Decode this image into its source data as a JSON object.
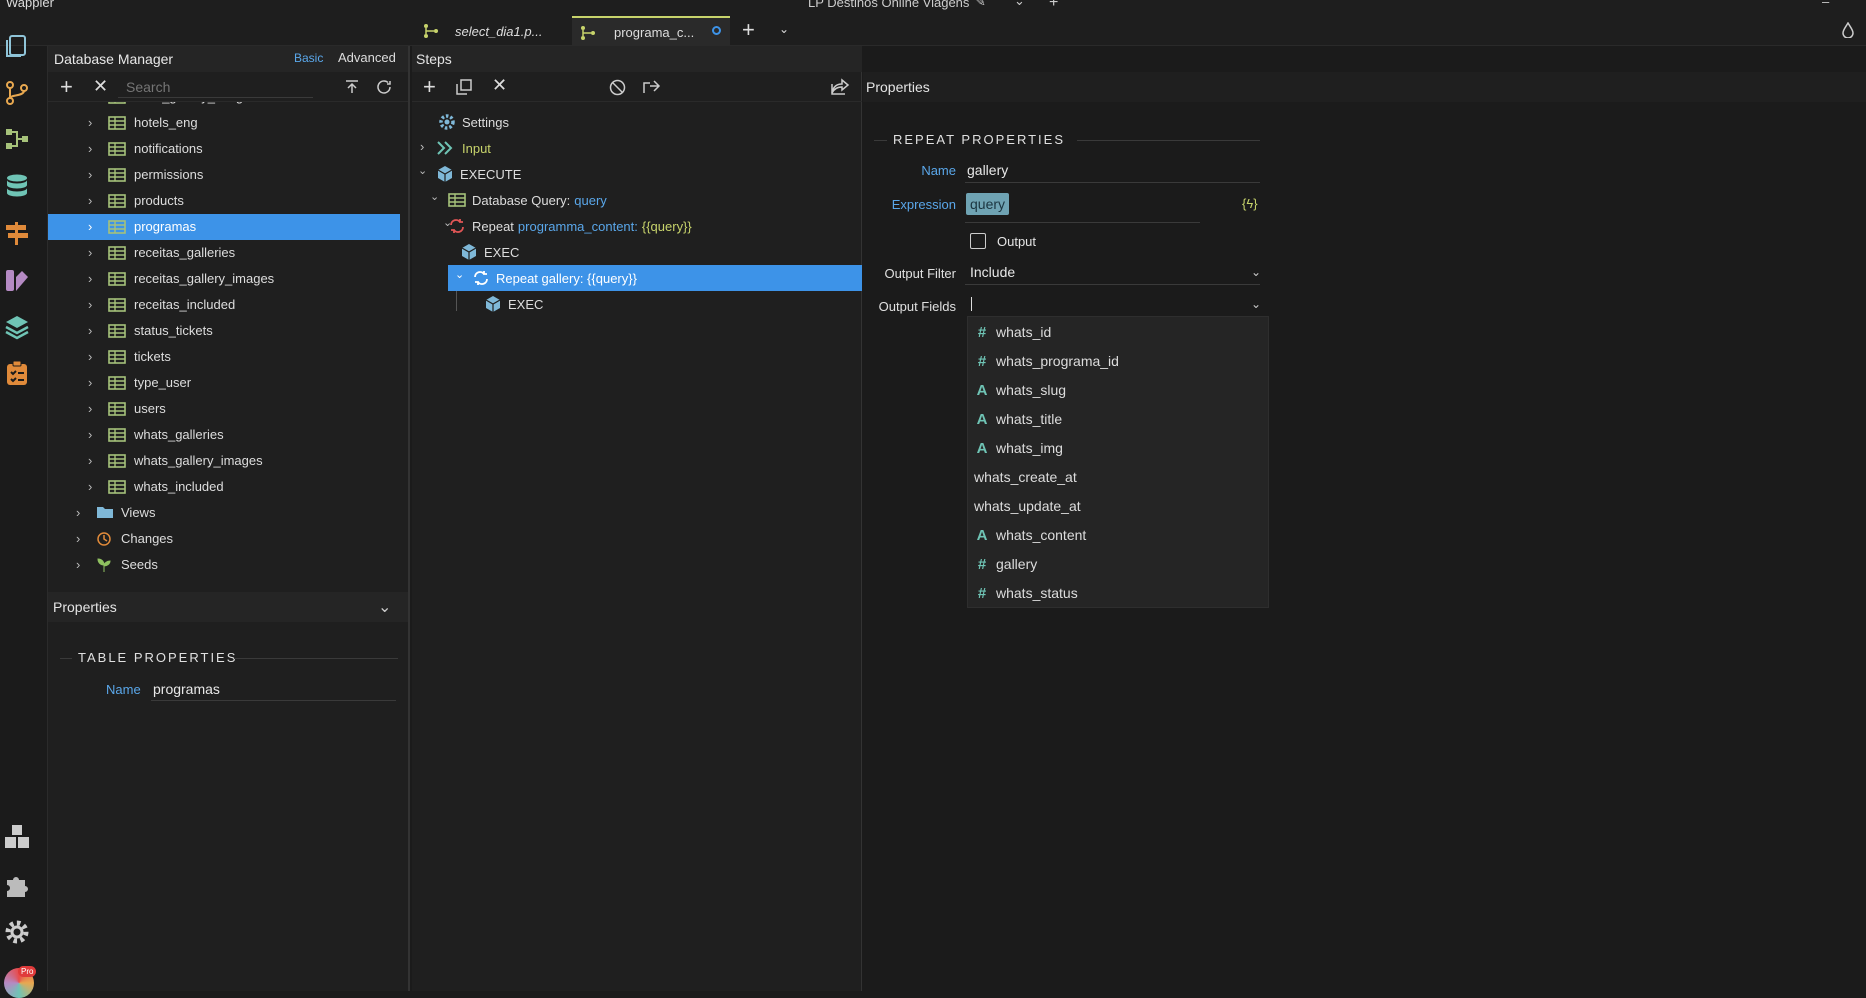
{
  "window": {
    "app_name": "Wappler",
    "project_title": "LP Destinos Online Viagens"
  },
  "tabs": [
    {
      "label": "select_dia1.p...",
      "active": false
    },
    {
      "label": "programa_c...",
      "active": true
    }
  ],
  "db_manager": {
    "title": "Database Manager",
    "mode_basic": "Basic",
    "mode_advanced": "Advanced",
    "search_placeholder": "Search",
    "tables": [
      "hotel_gallery_images",
      "hotels_eng",
      "notifications",
      "permissions",
      "products",
      "programas",
      "receitas_galleries",
      "receitas_gallery_images",
      "receitas_included",
      "status_tickets",
      "tickets",
      "type_user",
      "users",
      "whats_galleries",
      "whats_gallery_images",
      "whats_included"
    ],
    "selected_table": "programas",
    "groups": [
      "Views",
      "Changes",
      "Seeds"
    ]
  },
  "left_properties": {
    "title": "Properties",
    "section": "TABLE PROPERTIES",
    "name_label": "Name",
    "name_value": "programas"
  },
  "steps": {
    "title": "Steps",
    "settings": "Settings",
    "input": "Input",
    "execute": "EXECUTE",
    "db_query_label": "Database Query:",
    "db_query_name": "query",
    "repeat_label": "Repeat",
    "repeat_name": "programma_content:",
    "repeat_expr": "{{query}}",
    "exec1": "EXEC",
    "repeat_gallery": "Repeat gallery: {{query}}",
    "exec2": "EXEC"
  },
  "properties": {
    "title": "Properties",
    "section": "REPEAT PROPERTIES",
    "name_label": "Name",
    "name_value": "gallery",
    "expression_label": "Expression",
    "expression_value": "query",
    "output_label": "Output",
    "output_filter_label": "Output Filter",
    "output_filter_value": "Include",
    "output_fields_label": "Output Fields"
  },
  "fields": [
    {
      "name": "whats_id",
      "icon": "hash"
    },
    {
      "name": "whats_programa_id",
      "icon": "hash"
    },
    {
      "name": "whats_slug",
      "icon": "text"
    },
    {
      "name": "whats_title",
      "icon": "text"
    },
    {
      "name": "whats_img",
      "icon": "text"
    },
    {
      "name": "whats_create_at",
      "icon": "none"
    },
    {
      "name": "whats_update_at",
      "icon": "none"
    },
    {
      "name": "whats_content",
      "icon": "text"
    },
    {
      "name": "gallery",
      "icon": "hash"
    },
    {
      "name": "whats_status",
      "icon": "hash"
    }
  ],
  "colors": {
    "accent": "#3d93e8",
    "table_icon": "#a6c27a",
    "field_icon": "#6fc4b5",
    "link": "#5aa7ea",
    "yellow": "#c7d36b"
  }
}
